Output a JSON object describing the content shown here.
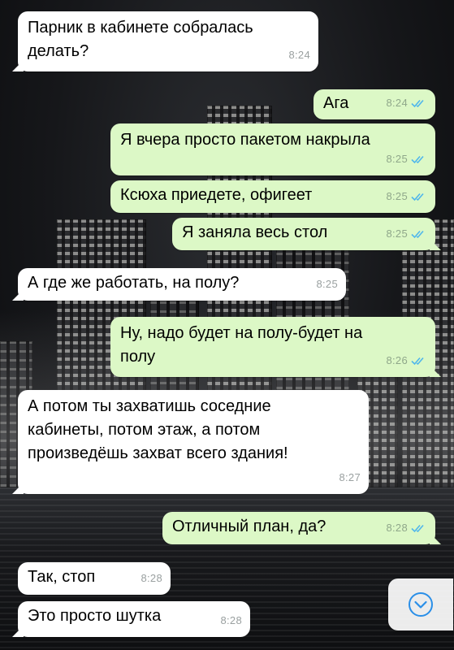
{
  "messages": [
    {
      "dir": "in",
      "text": "Парник в кабинете собралась\nделать?",
      "time": "8:24"
    },
    {
      "dir": "out",
      "text": "Ага",
      "time": "8:24"
    },
    {
      "dir": "out",
      "text": "Я вчера просто пакетом накрыла",
      "time": "8:25"
    },
    {
      "dir": "out",
      "text": "Ксюха приедете, офигеет",
      "time": "8:25"
    },
    {
      "dir": "out",
      "text": "Я заняла весь стол",
      "time": "8:25"
    },
    {
      "dir": "in",
      "text": "А где же работать, на полу?",
      "time": "8:25"
    },
    {
      "dir": "out",
      "text": "Ну, надо будет на полу-будет на\nполу",
      "time": "8:26"
    },
    {
      "dir": "in",
      "text": "А потом ты захватишь соседние\nкабинеты, потом этаж, а потом\nпроизведёшь захват всего здания!",
      "time": "8:27"
    },
    {
      "dir": "out",
      "text": "Отличный план, да?",
      "time": "8:28"
    },
    {
      "dir": "in",
      "text": "Так, стоп",
      "time": "8:28"
    },
    {
      "dir": "in",
      "text": "Это просто шутка",
      "time": "8:28"
    }
  ],
  "colors": {
    "incoming": "#ffffff",
    "outgoing": "#dcf8c6",
    "read_ticks": "#4fb6ec",
    "scroll_icon": "#2a8fe8"
  },
  "icons": {
    "read_status": "double-check-icon",
    "scroll_down": "chevron-down-circle-icon"
  }
}
